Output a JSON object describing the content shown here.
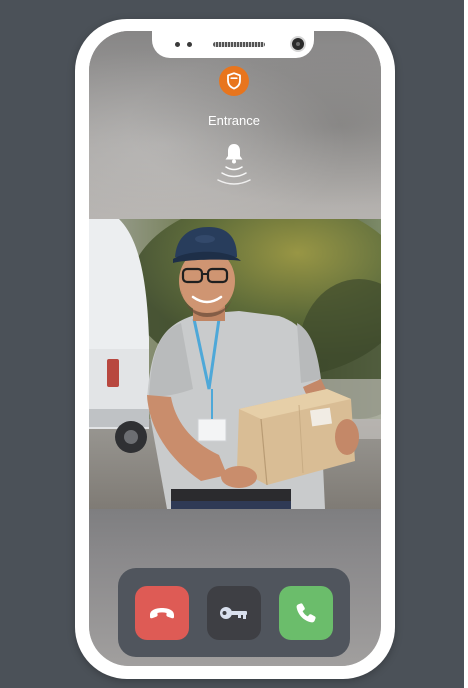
{
  "call": {
    "location_label": "Entrance",
    "status_icon": "bell-ringing-icon"
  },
  "app": {
    "brand_icon": "shield-icon",
    "accent_color": "#e8751d"
  },
  "controls": {
    "decline": {
      "icon": "phone-hangup-icon",
      "color": "#de5b55"
    },
    "unlock": {
      "icon": "key-icon",
      "color": "#3e3f44"
    },
    "accept": {
      "icon": "phone-answer-icon",
      "color": "#6bbd6b"
    }
  },
  "video_feed": {
    "subject": "delivery-person-holding-package"
  }
}
